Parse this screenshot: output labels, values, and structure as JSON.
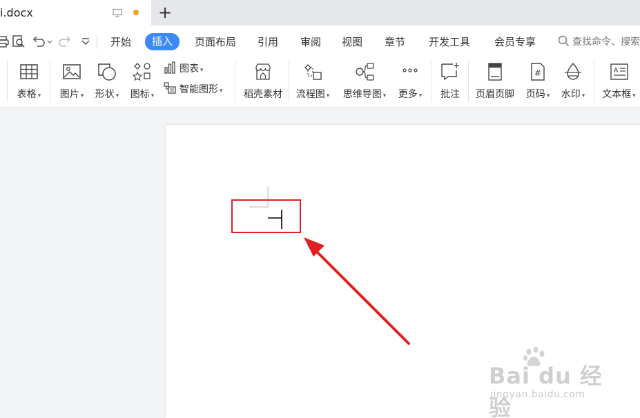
{
  "tab": {
    "title": "i.docx",
    "monitor_icon": "monitor-icon",
    "unsaved_dot_color": "#f0a020",
    "add_label": "+"
  },
  "quick_access": [
    {
      "icon": "print-icon"
    },
    {
      "icon": "print-preview-icon"
    },
    {
      "icon": "undo-icon"
    },
    {
      "icon": "redo-icon"
    },
    {
      "icon": "customize-dropdown-icon"
    }
  ],
  "menu": {
    "items": [
      "开始",
      "插入",
      "页面布局",
      "引用",
      "审阅",
      "视图",
      "章节",
      "开发工具",
      "会员专享"
    ],
    "active": "插入",
    "active_color": "#3d8af7",
    "search_text": "查找命令、搜索"
  },
  "ribbon": {
    "table": "表格",
    "picture": "图片",
    "shape": "形状",
    "icon": "图标",
    "chart": "图表",
    "smartart": "智能图形",
    "daoke": "稻壳素材",
    "flowchart": "流程图",
    "mindmap": "思维导图",
    "more": "更多",
    "comment": "批注",
    "header_footer": "页眉页脚",
    "page_number": "页码",
    "watermark": "水印",
    "textbox": "文本框"
  },
  "annotation": {
    "color": "#e02020"
  },
  "watermark": {
    "brand": "Bai du 经验",
    "url": "jingyan.baidu.com"
  }
}
